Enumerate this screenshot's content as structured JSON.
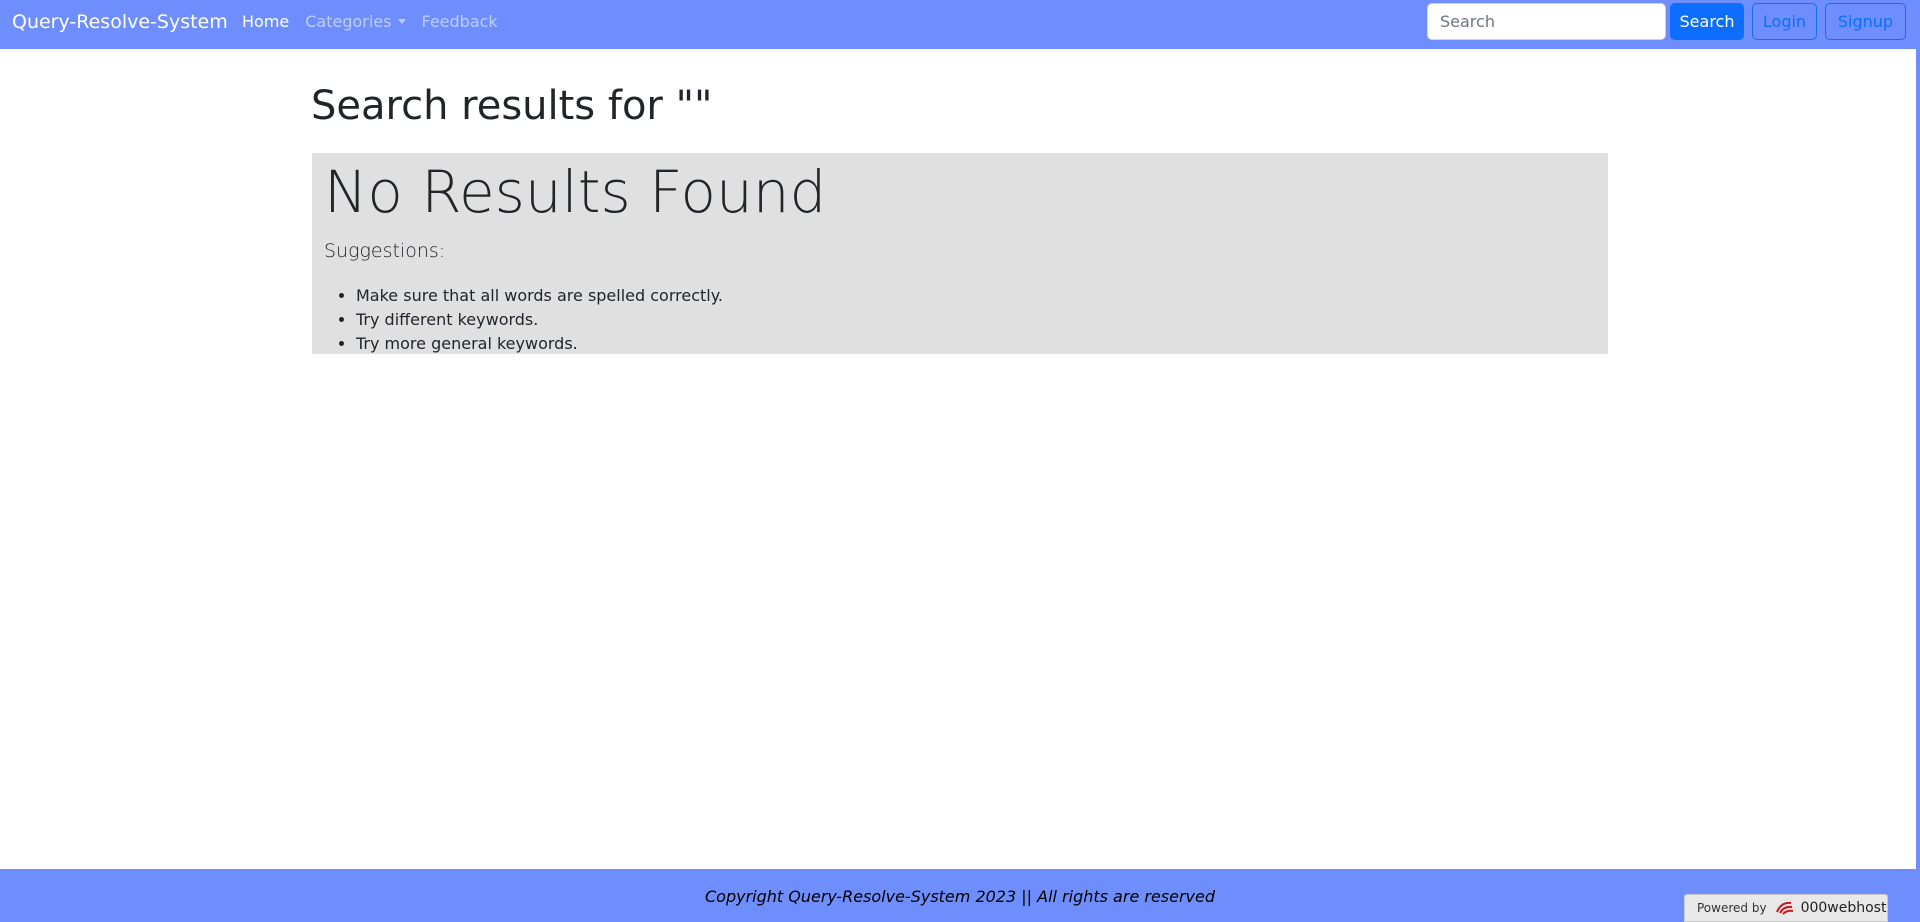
{
  "navbar": {
    "brand": "Query-Resolve-System",
    "links": [
      {
        "label": "Home",
        "active": true
      },
      {
        "label": "Categories",
        "dropdown": true
      },
      {
        "label": "Feedback"
      }
    ],
    "search": {
      "placeholder": "Search",
      "value": ""
    },
    "search_button": "Search",
    "login_button": "Login",
    "signup_button": "Signup"
  },
  "main": {
    "title": "Search results for  \"\"",
    "no_results_heading": "No Results Found",
    "suggestions_label": "Suggestions:",
    "suggestions": [
      "Make sure that all words are spelled correctly.",
      "Try different keywords.",
      "Try more general keywords."
    ]
  },
  "footer": {
    "copyright": "Copyright Query-Resolve-System 2023 || All rights are reserved",
    "powered_by_label": "Powered by",
    "powered_by_brand": "000webhost"
  },
  "colors": {
    "navbar_bg": "#6d8efc",
    "primary": "#0d6efd",
    "results_bg": "#e0e0e0",
    "footer_bg": "#6d8efc"
  }
}
